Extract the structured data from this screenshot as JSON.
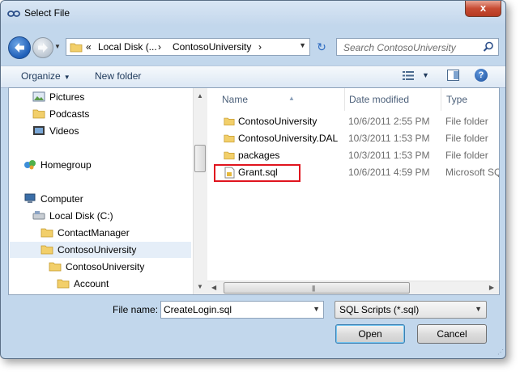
{
  "window": {
    "title": "Select File",
    "close_label": "x"
  },
  "address": {
    "crumbs": [
      "«",
      "Local Disk (...",
      "›",
      "ContosoUniversity",
      "›"
    ],
    "refresh_label": "↻"
  },
  "search": {
    "placeholder": "Search ContosoUniversity"
  },
  "toolbar": {
    "organize_label": "Organize",
    "new_folder_label": "New folder"
  },
  "nav_pane": {
    "items": [
      {
        "label": "Pictures",
        "icon": "pictures-icon"
      },
      {
        "label": "Podcasts",
        "icon": "folder-icon"
      },
      {
        "label": "Videos",
        "icon": "videos-icon"
      },
      {
        "label": "Homegroup",
        "icon": "homegroup-icon"
      },
      {
        "label": "Computer",
        "icon": "computer-icon"
      },
      {
        "label": "Local Disk (C:)",
        "icon": "drive-icon"
      },
      {
        "label": "ContactManager",
        "icon": "folder-icon"
      },
      {
        "label": "ContosoUniversity",
        "icon": "folder-icon",
        "selected": true
      },
      {
        "label": "ContosoUniversity",
        "icon": "folder-icon"
      },
      {
        "label": "Account",
        "icon": "folder-icon"
      }
    ]
  },
  "file_list": {
    "columns": [
      "Name",
      "Date modified",
      "Type"
    ],
    "rows": [
      {
        "name": "ContosoUniversity",
        "date": "10/6/2011 2:55 PM",
        "type": "File folder",
        "icon": "folder-icon"
      },
      {
        "name": "ContosoUniversity.DAL",
        "date": "10/3/2011 1:53 PM",
        "type": "File folder",
        "icon": "folder-icon"
      },
      {
        "name": "packages",
        "date": "10/3/2011 1:53 PM",
        "type": "File folder",
        "icon": "folder-icon"
      },
      {
        "name": "Grant.sql",
        "date": "10/6/2011 4:59 PM",
        "type": "Microsoft SQ",
        "icon": "sql-file-icon",
        "highlighted": true
      }
    ]
  },
  "footer": {
    "file_name_label": "File name:",
    "file_name_value": "CreateLogin.sql",
    "filter_value": "SQL Scripts (*.sql)",
    "open_label": "Open",
    "cancel_label": "Cancel"
  },
  "colors": {
    "highlight_border": "#e0141e",
    "window_frame": "#c2d7ec",
    "selected_bg": "#e5eef8"
  }
}
